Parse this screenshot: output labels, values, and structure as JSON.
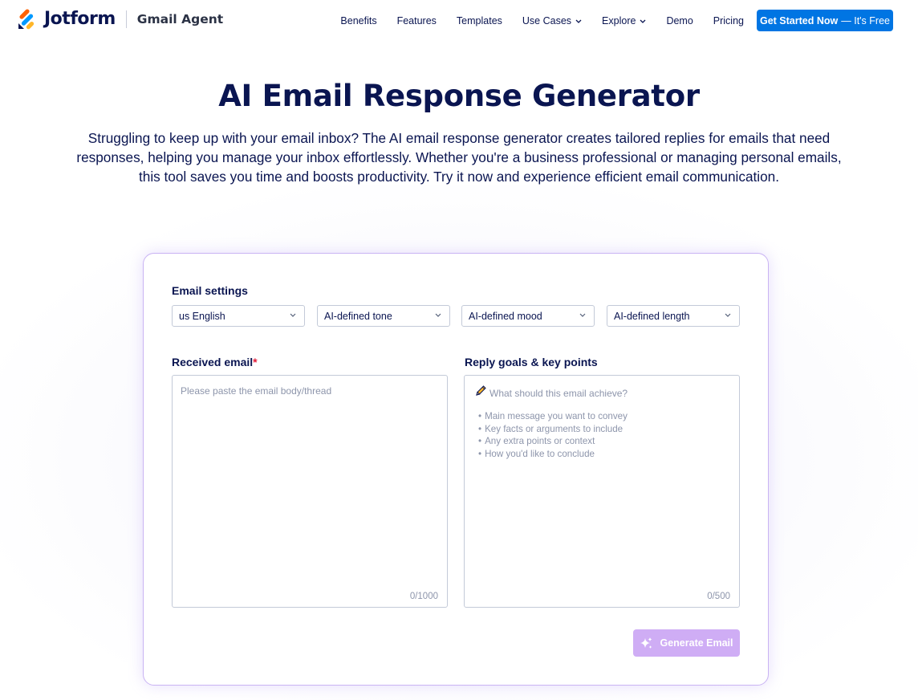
{
  "brand": {
    "name": "Jotform",
    "product": "Gmail Agent"
  },
  "nav": {
    "items": [
      {
        "label": "Benefits",
        "dropdown": false
      },
      {
        "label": "Features",
        "dropdown": false
      },
      {
        "label": "Templates",
        "dropdown": false
      },
      {
        "label": "Use Cases",
        "dropdown": true
      },
      {
        "label": "Explore",
        "dropdown": true
      },
      {
        "label": "Demo",
        "dropdown": false
      },
      {
        "label": "Pricing",
        "dropdown": false
      }
    ],
    "cta_bold": "Get Started Now",
    "cta_rest": "— It's Free"
  },
  "hero": {
    "title": "AI Email Response Generator",
    "description": "Struggling to keep up with your email inbox? The AI email response generator creates tailored replies for emails that need responses, helping you manage your inbox effortlessly. Whether you're a business professional or managing personal emails, this tool saves you time and boosts productivity. Try it now and experience efficient email communication."
  },
  "settings": {
    "label": "Email settings",
    "language": "us English",
    "tone": "AI-defined tone",
    "mood": "AI-defined mood",
    "length": "AI-defined length"
  },
  "received": {
    "label": "Received email",
    "required_mark": "*",
    "value": "",
    "placeholder": "Please paste the email body/thread",
    "counter": "0/1000"
  },
  "goals": {
    "label": "Reply goals & key points",
    "value": "",
    "placeholder": "What should this email achieve?",
    "bullets": [
      "Main message you want to convey",
      "Key facts or arguments to include",
      "Any extra points or context",
      "How you'd like to conclude"
    ],
    "counter": "0/500"
  },
  "generate": {
    "label": "Generate Email"
  },
  "colors": {
    "navy": "#0a1551",
    "cta_blue": "#0075e3",
    "generate_disabled": "#cfadf5",
    "card_border": "#c9b3f3",
    "required": "#e31b37"
  }
}
